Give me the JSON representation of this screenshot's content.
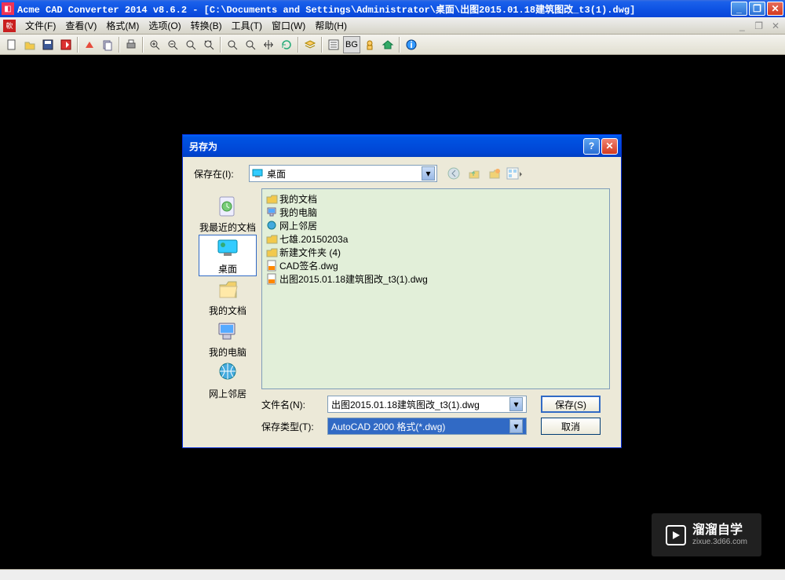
{
  "window": {
    "title": "Acme CAD Converter 2014 v8.6.2 - [C:\\Documents and Settings\\Administrator\\桌面\\出图2015.01.18建筑图改_t3(1).dwg]"
  },
  "menu": {
    "items": [
      "文件(F)",
      "查看(V)",
      "格式(M)",
      "选项(O)",
      "转换(B)",
      "工具(T)",
      "窗口(W)",
      "帮助(H)"
    ]
  },
  "toolbar": {
    "bg_label": "BG"
  },
  "dialog": {
    "title": "另存为",
    "savein_label": "保存在(I):",
    "location": "桌面",
    "places": [
      "我最近的文档",
      "桌面",
      "我的文档",
      "我的电脑",
      "网上邻居"
    ],
    "files": [
      {
        "icon": "folder-docs",
        "name": "我的文档"
      },
      {
        "icon": "computer",
        "name": "我的电脑"
      },
      {
        "icon": "network",
        "name": "网上邻居"
      },
      {
        "icon": "folder",
        "name": "七雄.20150203a"
      },
      {
        "icon": "folder",
        "name": "新建文件夹 (4)"
      },
      {
        "icon": "dwg",
        "name": "CAD签名.dwg"
      },
      {
        "icon": "dwg",
        "name": "出图2015.01.18建筑图改_t3(1).dwg"
      }
    ],
    "filename_label": "文件名(N):",
    "filename_value": "出图2015.01.18建筑图改_t3(1).dwg",
    "filetype_label": "保存类型(T):",
    "filetype_value": "AutoCAD 2000 格式(*.dwg)",
    "save_btn": "保存(S)",
    "cancel_btn": "取消"
  },
  "watermark": {
    "brand": "溜溜自学",
    "url": "zixue.3d66.com"
  },
  "statusbar": {
    "text": " "
  }
}
